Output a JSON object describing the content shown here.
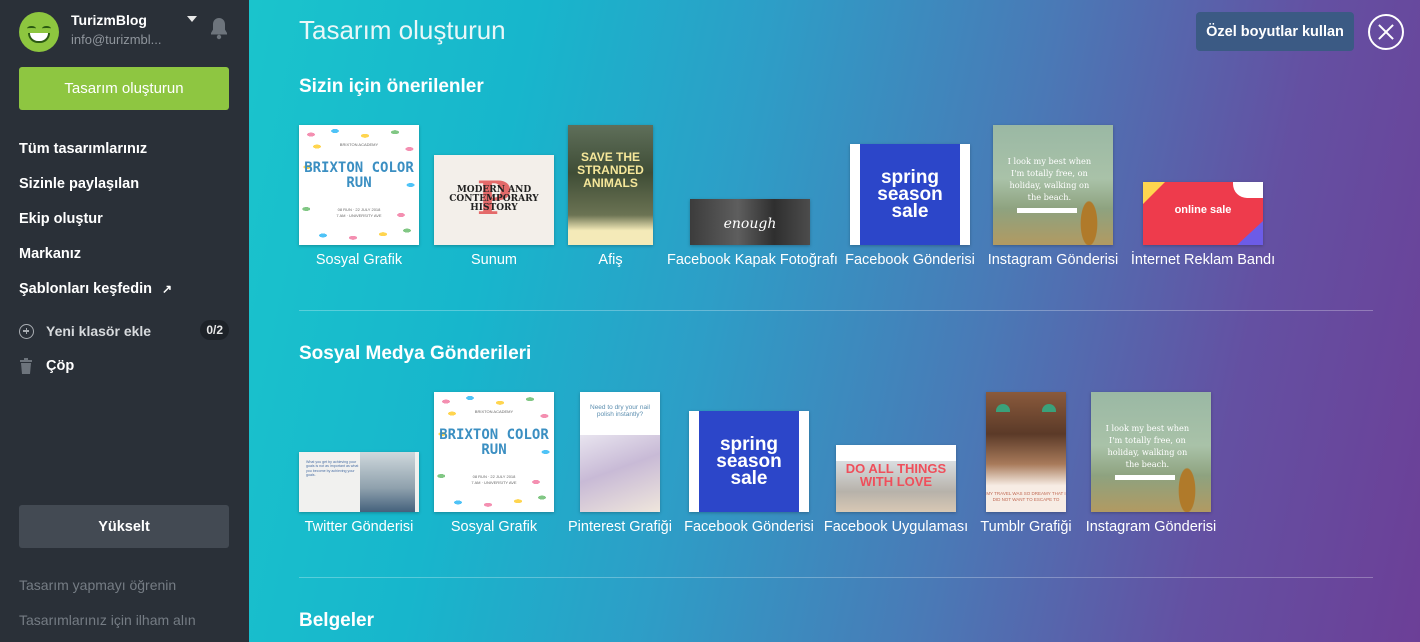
{
  "account": {
    "name": "TurizmBlog",
    "email": "info@turizmbl..."
  },
  "sidebar": {
    "create_label": "Tasarım oluşturun",
    "nav": [
      {
        "label": "Tüm tasarımlarınız"
      },
      {
        "label": "Sizinle paylaşılan"
      },
      {
        "label": "Ekip oluştur"
      },
      {
        "label": "Markanız"
      },
      {
        "label": "Şablonları keşfedin"
      }
    ],
    "new_folder_label": "Yeni klasör ekle",
    "folder_count": "0/2",
    "trash_label": "Çöp",
    "upgrade_label": "Yükselt",
    "footer_links": [
      "Tasarım yapmayı öğrenin",
      "Tasarımlarınız için ilham alın"
    ]
  },
  "main": {
    "title": "Tasarım oluşturun",
    "custom_size_label": "Özel boyutlar kullan",
    "sections": [
      {
        "title": "Sizin için önerilenler",
        "items": [
          {
            "label": "Sosyal Grafik",
            "thumb": {
              "title": "BRIXTON COLOR RUN",
              "kicker": "BRIXTON ACADEMY",
              "lines": [
                "08 RUN · 22 JULY 2018",
                "7 AM · UNIVERSITY AVE"
              ]
            }
          },
          {
            "label": "Sunum",
            "thumb": {
              "letter": "P",
              "title": "MODERN AND CONTEMPORARY HISTORY"
            }
          },
          {
            "label": "Afiş",
            "thumb": {
              "title": "SAVE THE STRANDED ANIMALS"
            }
          },
          {
            "label": "Facebook Kapak Fotoğrafı",
            "thumb": {
              "title": "enough"
            }
          },
          {
            "label": "Facebook Gönderisi",
            "thumb": {
              "title": "spring season sale"
            }
          },
          {
            "label": "Instagram Gönderisi",
            "thumb": {
              "title": "I look my best when I'm totally free, on holiday, walking on the beach."
            }
          },
          {
            "label": "İnternet Reklam Bandı",
            "thumb": {
              "title": "online sale"
            }
          }
        ]
      },
      {
        "title": "Sosyal Medya Gönderileri",
        "items": [
          {
            "label": "Twitter Gönderisi",
            "thumb": {
              "title": "What you get by achieving your goals is not as important as what you become by achieving your goals."
            }
          },
          {
            "label": "Sosyal Grafik",
            "thumb": {
              "title": "BRIXTON COLOR RUN",
              "kicker": "BRIXTON ACADEMY",
              "lines": [
                "08 RUN · 22 JULY 2018",
                "7 AM · UNIVERSITY AVE"
              ]
            }
          },
          {
            "label": "Pinterest Grafiği",
            "thumb": {
              "title": "Need to dry your nail polish instantly?"
            }
          },
          {
            "label": "Facebook Gönderisi",
            "thumb": {
              "title": "spring season sale"
            }
          },
          {
            "label": "Facebook Uygulaması",
            "thumb": {
              "title": "DO ALL THINGS WITH LOVE"
            }
          },
          {
            "label": "Tumblr Grafiği",
            "thumb": {
              "title": "MY TRAVEL WAS SO DREAMY THAT I DID NOT WANT TO ESCAPE TO"
            }
          },
          {
            "label": "Instagram Gönderisi",
            "thumb": {
              "title": "I look my best when I'm totally free, on holiday, walking on the beach."
            }
          }
        ]
      },
      {
        "title": "Belgeler",
        "items": []
      }
    ]
  },
  "colors": {
    "sidebar": "#2a3038",
    "accent_green": "#8ec641",
    "gradient_start": "#1ac4cc",
    "gradient_end": "#6c3f97"
  }
}
